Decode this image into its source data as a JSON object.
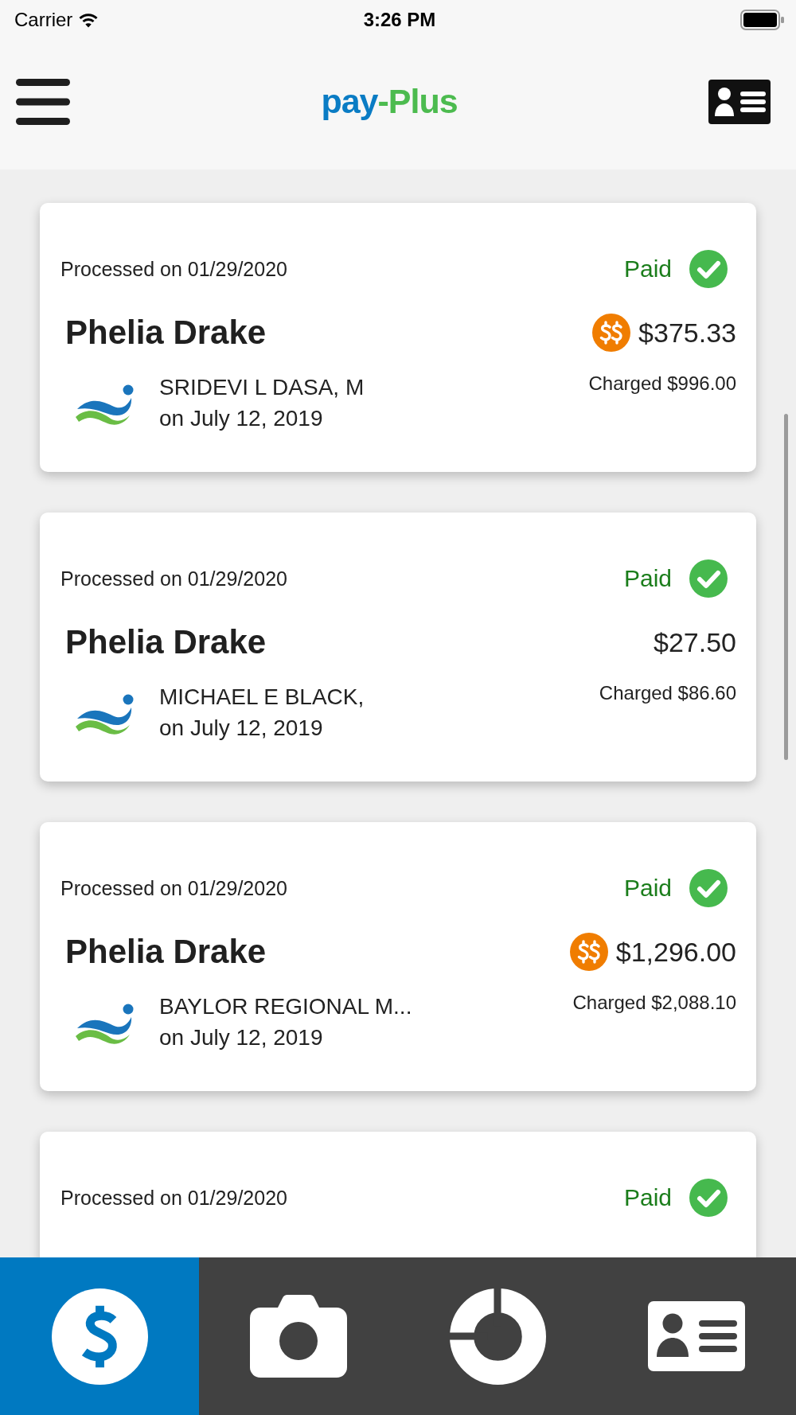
{
  "status_bar": {
    "carrier": "Carrier",
    "time": "3:26 PM"
  },
  "header": {
    "logo": [
      {
        "text": "pay",
        "color": "#0a7cc4"
      },
      {
        "text": "-Plus",
        "color": "#4cbb4f"
      }
    ]
  },
  "claims": [
    {
      "processed": "Processed on 01/29/2020",
      "status": "Paid",
      "patient": "Phelia Drake",
      "savings": true,
      "amount": "$375.33",
      "charged": "Charged $996.00",
      "provider": "SRIDEVI L DASA, M",
      "visit_date": "on July 12, 2019"
    },
    {
      "processed": "Processed on 01/29/2020",
      "status": "Paid",
      "patient": "Phelia Drake",
      "savings": false,
      "amount": "$27.50",
      "charged": "Charged $86.60",
      "provider": "MICHAEL E BLACK,",
      "visit_date": "on July 12, 2019"
    },
    {
      "processed": "Processed on 01/29/2020",
      "status": "Paid",
      "patient": "Phelia Drake",
      "savings": true,
      "amount": "$1,296.00",
      "charged": "Charged $2,088.10",
      "provider": "BAYLOR REGIONAL M...",
      "visit_date": "on July 12, 2019"
    },
    {
      "processed": "Processed on 01/29/2020",
      "status": "Paid"
    }
  ],
  "tabs": [
    {
      "kind": "dollar",
      "selected": true
    },
    {
      "kind": "camera",
      "selected": false
    },
    {
      "kind": "donut",
      "selected": false
    },
    {
      "kind": "idcard",
      "selected": false
    }
  ]
}
